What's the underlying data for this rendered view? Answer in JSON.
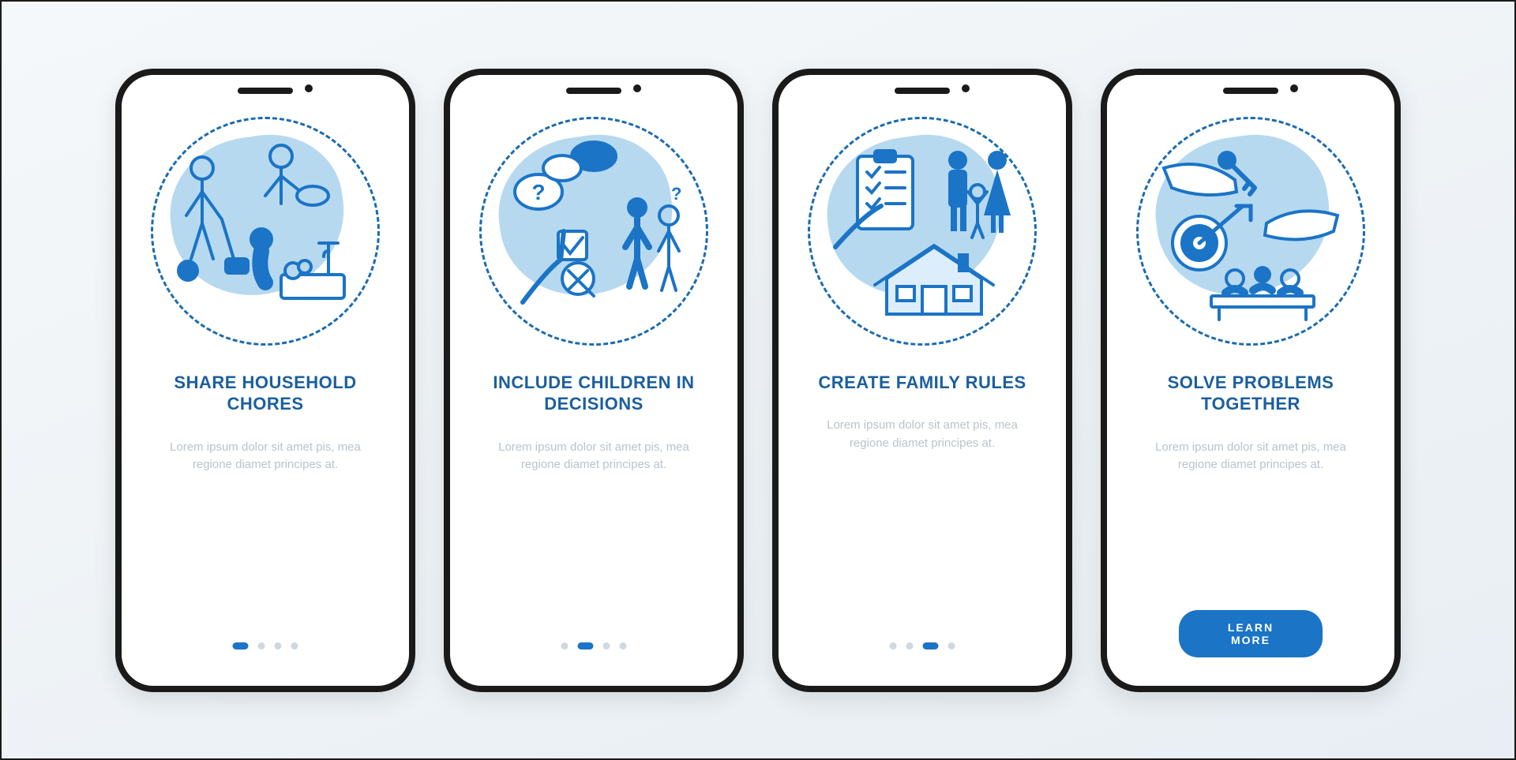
{
  "colors": {
    "primary": "#1b74c6",
    "accent": "#1b5f9e",
    "light": "#b6d9ef"
  },
  "cta_label": "LEARN MORE",
  "description": "Lorem ipsum dolor sit amet pis, mea regione diamet principes at.",
  "screens": [
    {
      "title": "SHARE HOUSEHOLD CHORES",
      "active_dot": 0,
      "icon": "household-chores-icon"
    },
    {
      "title": "INCLUDE CHILDREN IN DECISIONS",
      "active_dot": 1,
      "icon": "children-decisions-icon"
    },
    {
      "title": "CREATE FAMILY RULES",
      "active_dot": 2,
      "icon": "family-rules-icon"
    },
    {
      "title": "SOLVE PROBLEMS TOGETHER",
      "active_dot": 3,
      "icon": "solve-problems-icon"
    }
  ]
}
